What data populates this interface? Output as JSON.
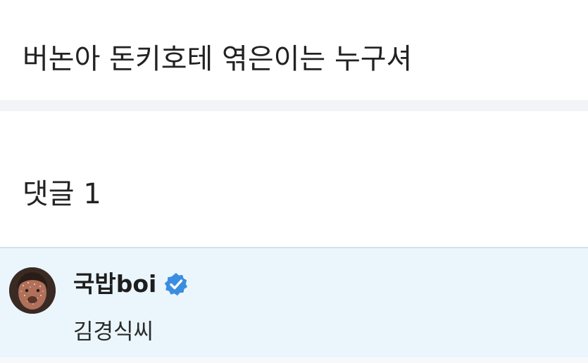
{
  "question": {
    "text": "버논아 돈키호테 엮은이는 누구셔"
  },
  "comments": {
    "title": "댓글 1",
    "items": [
      {
        "author": "국밥boi",
        "verified": true,
        "text": "김경식씨",
        "avatar_icon": "user-avatar"
      }
    ]
  },
  "colors": {
    "comment_bg": "#ebf6fc",
    "verified_badge": "#3b8de0",
    "divider": "#f3f4f7"
  }
}
